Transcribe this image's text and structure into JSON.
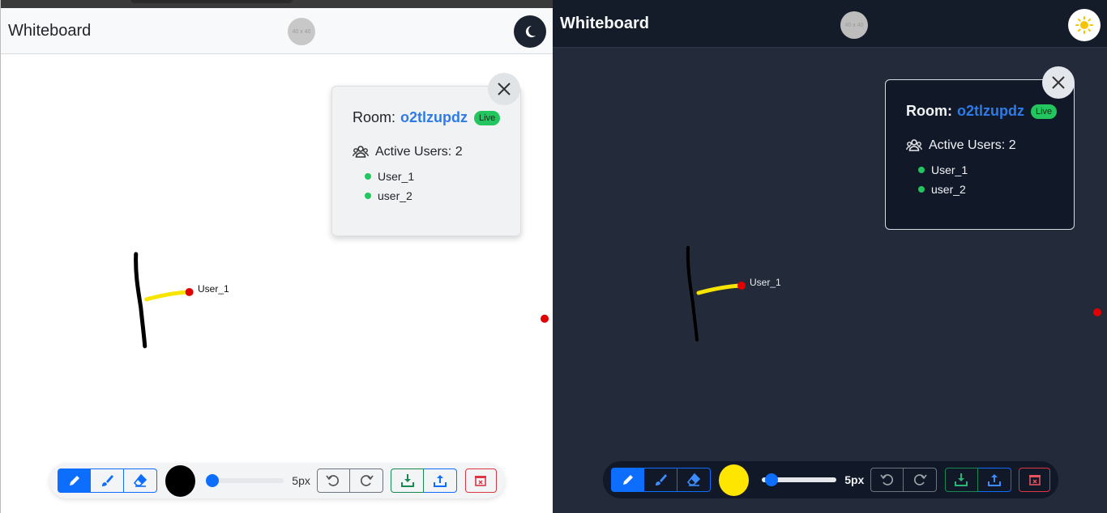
{
  "light": {
    "header": {
      "title": "Whiteboard",
      "avatar_text": "40 x 40",
      "theme_icon": "moon-icon"
    },
    "room": {
      "label": "Room:",
      "id": "o2tlzupdz",
      "status": "Live",
      "active_users_label": "Active Users: 2",
      "users": [
        "User_1",
        "user_2"
      ]
    },
    "cursor": {
      "label": "User_1"
    },
    "toolbar": {
      "size_label": "5px",
      "brush_size": 5,
      "color": "#000000"
    }
  },
  "dark": {
    "header": {
      "title": "Whiteboard",
      "avatar_text": "40 x 40",
      "theme_icon": "sun-icon"
    },
    "room": {
      "label": "Room:",
      "id": "o2tlzupdz",
      "status": "Live",
      "active_users_label": "Active Users: 2",
      "users": [
        "User_1",
        "user_2"
      ]
    },
    "cursor": {
      "label": "User_1"
    },
    "toolbar": {
      "size_label": "5px",
      "brush_size": 5,
      "color": "#ffe600"
    }
  },
  "colors": {
    "accent": "#0d6efd",
    "live": "#22c55e",
    "cursor": "#e00000",
    "stroke_highlight": "#f7e400"
  }
}
